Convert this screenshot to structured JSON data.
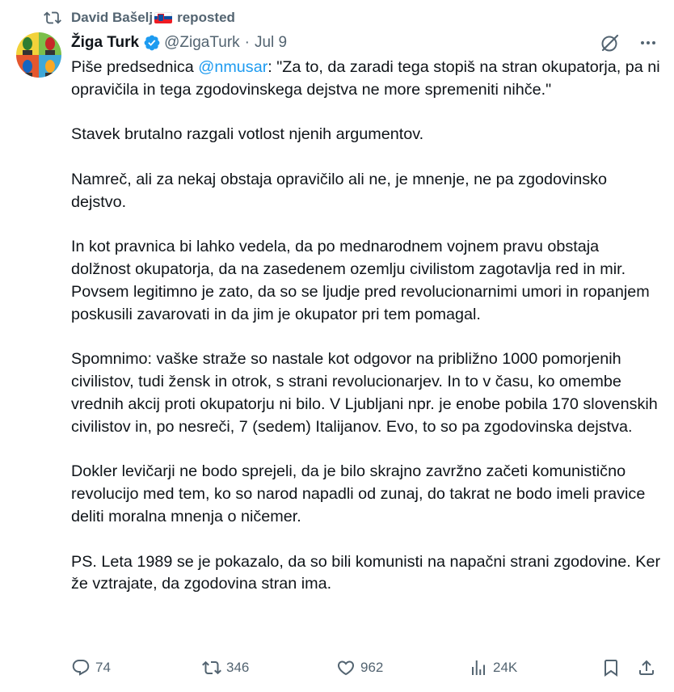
{
  "repost": {
    "user": "David Bašelj",
    "flag": "slovenia-flag",
    "label": "reposted"
  },
  "author": {
    "name": "Žiga Turk",
    "handle": "@ZigaTurk",
    "separator": "·",
    "date": "Jul 9",
    "verified_color": "#1d9bf0"
  },
  "tweet": {
    "intro_before": "Piše predsednica ",
    "mention": "@nmusar",
    "intro_after": ": \"Za to, da zaradi tega stopiš na stran okupatorja, pa ni opravičila in tega zgodovinskega dejstva ne more spremeniti nihče.\"",
    "paragraphs": [
      "Stavek brutalno razgali votlost njenih argumentov.",
      "Namreč, ali za nekaj obstaja opravičilo ali ne, je mnenje, ne pa zgodovinsko dejstvo.",
      "In kot pravnica bi lahko vedela, da po mednarodnem vojnem pravu obstaja dolžnost okupatorja, da na zasedenem ozemlju civilistom zagotavlja red in mir. Povsem legitimno je zato, da so se ljudje pred revolucionarnimi umori in ropanjem poskusili zavarovati in da jim je okupator pri tem pomagal.",
      "Spomnimo: vaške straže so nastale kot odgovor na približno 1000 pomorjenih civilistov, tudi žensk in otrok, s strani revolucionarjev. In to v času, ko omembe vrednih akcij proti okupatorju ni bilo. V Ljubljani npr. je enobe pobila 170 slovenskih civilistov in, po nesreči, 7 (sedem) Italijanov. Evo, to so pa zgodovinska dejstva.",
      "Dokler levičarji ne bodo sprejeli, da je bilo skrajno zavržno začeti komunistično revolucijo med tem, ko so narod napadli od zunaj, do takrat ne bodo imeli pravice deliti moralna mnenja o ničemer.",
      "PS. Leta 1989 se je pokazalo, da so bili komunisti na napačni strani zgodovine. Ker že vztrajate, da zgodovina stran ima."
    ]
  },
  "actions": {
    "replies": "74",
    "reposts": "346",
    "likes": "962",
    "views": "24K"
  },
  "icons": {
    "repost": "repost-icon",
    "verified": "verified-badge-icon",
    "grok": "grok-icon",
    "more": "more-icon",
    "reply": "reply-icon",
    "like": "heart-icon",
    "views": "views-icon",
    "bookmark": "bookmark-icon",
    "share": "share-icon"
  },
  "colors": {
    "text": "#0f1419",
    "secondary": "#536471",
    "link": "#1d9bf0"
  }
}
